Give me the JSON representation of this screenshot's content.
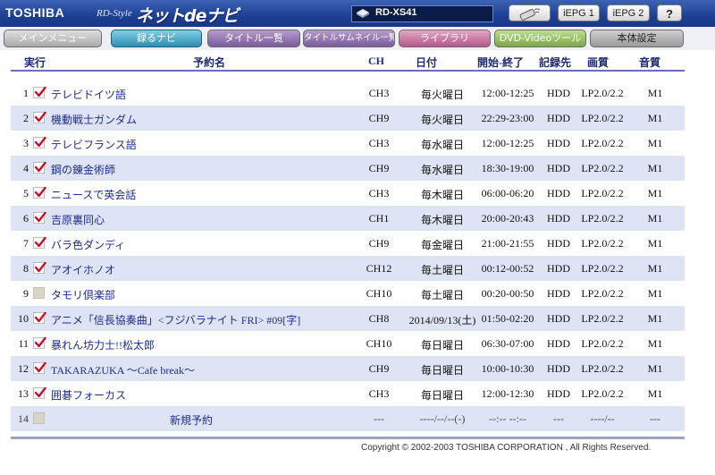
{
  "header": {
    "brand": "TOSHIBA",
    "product_sub": "RD-Style",
    "product_name": "ネットdeナビ",
    "model": "RD-XS41",
    "buttons": {
      "iepg1": "iEPG 1",
      "iepg2": "iEPG 2",
      "help": "?"
    }
  },
  "nav": {
    "tabs": [
      {
        "label": "メインメニュー"
      },
      {
        "label": "録るナビ"
      },
      {
        "label": "タイトル一覧"
      },
      {
        "label": "タイトルサムネイル一覧"
      },
      {
        "label": "ライブラリ"
      },
      {
        "label": "DVD-Videoツール"
      },
      {
        "label": "本体設定"
      }
    ]
  },
  "table": {
    "headers": {
      "exec": "実行",
      "name": "予約名",
      "ch": "CH",
      "date": "日付",
      "time": "開始-終了",
      "dest": "記録先",
      "quality": "画質",
      "audio": "音質"
    },
    "rows": [
      {
        "no": "1",
        "checked": true,
        "name": "テレビドイツ語",
        "ch": "CH3",
        "date": "毎火曜日",
        "time": "12:00-12:25",
        "dest": "HDD",
        "quality": "LP2.0/2.2",
        "audio": "M1"
      },
      {
        "no": "2",
        "checked": true,
        "name": "機動戦士ガンダム",
        "ch": "CH9",
        "date": "毎火曜日",
        "time": "22:29-23:00",
        "dest": "HDD",
        "quality": "LP2.0/2.2",
        "audio": "M1"
      },
      {
        "no": "3",
        "checked": true,
        "name": "テレビフランス語",
        "ch": "CH3",
        "date": "毎水曜日",
        "time": "12:00-12:25",
        "dest": "HDD",
        "quality": "LP2.0/2.2",
        "audio": "M1"
      },
      {
        "no": "4",
        "checked": true,
        "name": "鋼の錬金術師",
        "ch": "CH9",
        "date": "毎水曜日",
        "time": "18:30-19:00",
        "dest": "HDD",
        "quality": "LP2.0/2.2",
        "audio": "M1"
      },
      {
        "no": "5",
        "checked": true,
        "name": "ニュースで英会話",
        "ch": "CH3",
        "date": "毎木曜日",
        "time": "06:00-06:20",
        "dest": "HDD",
        "quality": "LP2.0/2.2",
        "audio": "M1"
      },
      {
        "no": "6",
        "checked": true,
        "name": "吉原裏同心",
        "ch": "CH1",
        "date": "毎木曜日",
        "time": "20:00-20:43",
        "dest": "HDD",
        "quality": "LP2.0/2.2",
        "audio": "M1"
      },
      {
        "no": "7",
        "checked": true,
        "name": "バラ色ダンディ",
        "ch": "CH9",
        "date": "毎金曜日",
        "time": "21:00-21:55",
        "dest": "HDD",
        "quality": "LP2.0/2.2",
        "audio": "M1"
      },
      {
        "no": "8",
        "checked": true,
        "name": "アオイホノオ",
        "ch": "CH12",
        "date": "毎土曜日",
        "time": "00:12-00:52",
        "dest": "HDD",
        "quality": "LP2.0/2.2",
        "audio": "M1"
      },
      {
        "no": "9",
        "checked": false,
        "name": "タモリ倶楽部",
        "ch": "CH10",
        "date": "毎土曜日",
        "time": "00:20-00:50",
        "dest": "HDD",
        "quality": "LP2.0/2.2",
        "audio": "M1"
      },
      {
        "no": "10",
        "checked": true,
        "name": "アニメ「信長協奏曲」<フジバラナイト FRI> #09[字]",
        "ch": "CH8",
        "date": "2014/09/13(土)",
        "time": "01:50-02:20",
        "dest": "HDD",
        "quality": "LP2.0/2.2",
        "audio": "M1"
      },
      {
        "no": "11",
        "checked": true,
        "name": "暴れん坊力士!!松太郎",
        "ch": "CH10",
        "date": "毎日曜日",
        "time": "06:30-07:00",
        "dest": "HDD",
        "quality": "LP2.0/2.2",
        "audio": "M1"
      },
      {
        "no": "12",
        "checked": true,
        "name": "TAKARAZUKA 〜Cafe break〜",
        "ch": "CH9",
        "date": "毎日曜日",
        "time": "10:00-10:30",
        "dest": "HDD",
        "quality": "LP2.0/2.2",
        "audio": "M1"
      },
      {
        "no": "13",
        "checked": true,
        "name": "囲碁フォーカス",
        "ch": "CH3",
        "date": "毎日曜日",
        "time": "12:00-12:30",
        "dest": "HDD",
        "quality": "LP2.0/2.2",
        "audio": "M1"
      }
    ],
    "new_row": {
      "no": "14",
      "name": "新規予約",
      "ch": "---",
      "date": "----/--/--(-)",
      "time": "--:-- --:--",
      "dest": "---",
      "quality": "----/--",
      "audio": "---"
    }
  },
  "footer": {
    "copyright": "Copyright © 2002-2003 TOSHIBA CORPORATION , All Rights Reserved."
  },
  "colors": {
    "header_blue": "#1d3f92",
    "row_alt": "#dfe4f4",
    "link_blue": "#1d2d8c",
    "check_red": "#c8102e"
  }
}
